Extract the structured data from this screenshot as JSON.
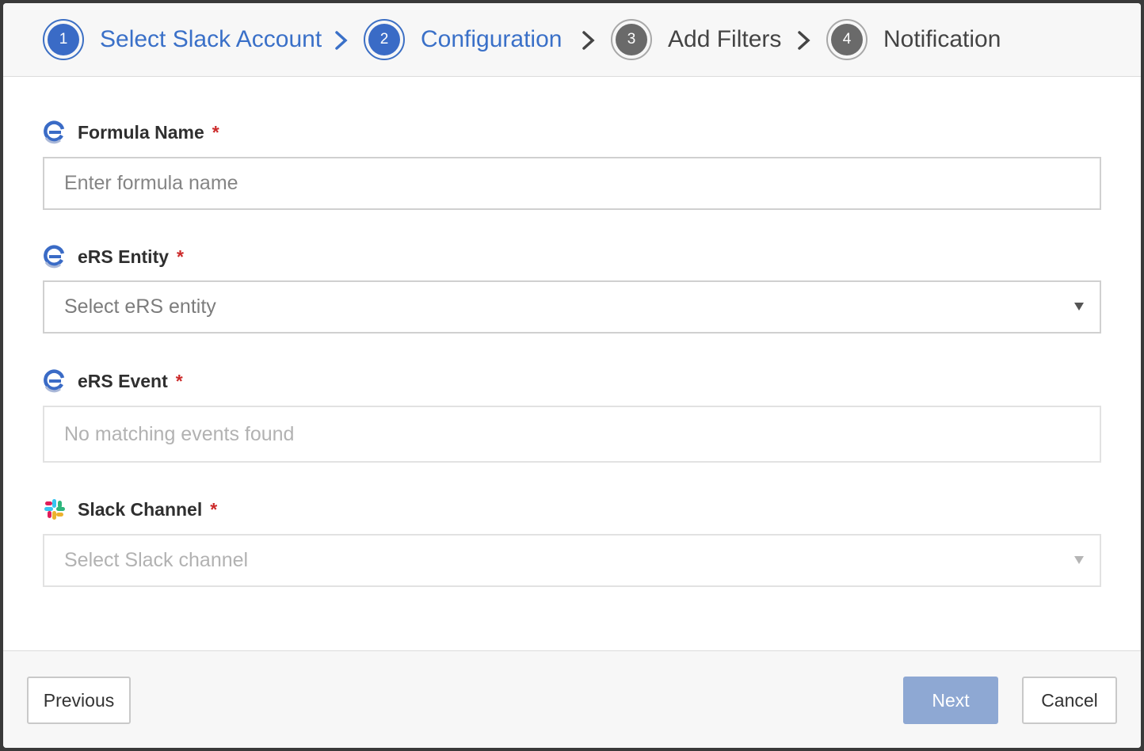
{
  "stepper": {
    "steps": [
      {
        "number": "1",
        "label": "Select Slack Account",
        "state": "active"
      },
      {
        "number": "2",
        "label": "Configuration",
        "state": "active"
      },
      {
        "number": "3",
        "label": "Add Filters",
        "state": "inactive"
      },
      {
        "number": "4",
        "label": "Notification",
        "state": "inactive"
      }
    ]
  },
  "form": {
    "formula_name": {
      "label": "Formula Name",
      "required": "*",
      "placeholder": "Enter formula name",
      "icon": "ers-logo-icon"
    },
    "ers_entity": {
      "label": "eRS Entity",
      "required": "*",
      "placeholder": "Select eRS entity",
      "icon": "ers-logo-icon"
    },
    "ers_event": {
      "label": "eRS Event",
      "required": "*",
      "placeholder": "No matching events found",
      "icon": "ers-logo-icon"
    },
    "slack_channel": {
      "label": "Slack Channel",
      "required": "*",
      "placeholder": "Select Slack channel",
      "icon": "slack-logo-icon"
    }
  },
  "footer": {
    "previous_label": "Previous",
    "next_label": "Next",
    "cancel_label": "Cancel"
  },
  "colors": {
    "accent": "#3a6bc6",
    "required": "#cc2a2a",
    "next_disabled": "#8ea8d3"
  }
}
